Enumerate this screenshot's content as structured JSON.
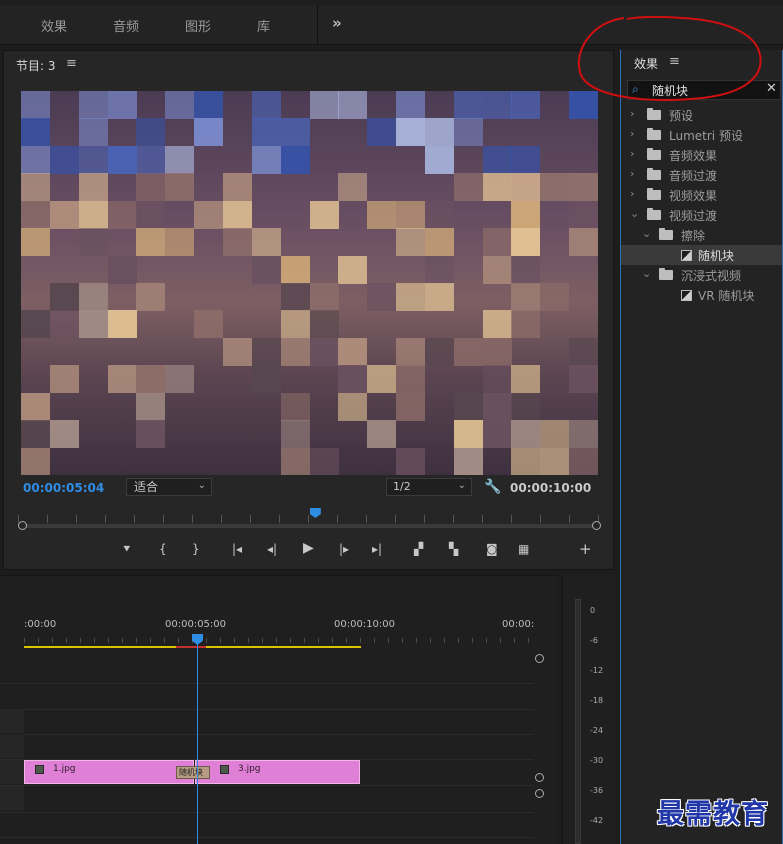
{
  "top_tabs": [
    "效果",
    "音频",
    "图形",
    "库"
  ],
  "program_monitor": {
    "title": "节目: 3",
    "current_timecode": "00:00:05:04",
    "fit_option": "适合",
    "resolution": "1/2",
    "duration_timecode": "00:00:10:00",
    "playhead_fraction": 0.51
  },
  "effects_panel": {
    "title": "效果",
    "search_value": "随机块",
    "tree": [
      {
        "label": "预设",
        "level": 0,
        "expanded": false,
        "type": "folder-star"
      },
      {
        "label": "Lumetri 预设",
        "level": 0,
        "expanded": false,
        "type": "folder-star"
      },
      {
        "label": "音频效果",
        "level": 0,
        "expanded": false,
        "type": "folder"
      },
      {
        "label": "音频过渡",
        "level": 0,
        "expanded": false,
        "type": "folder"
      },
      {
        "label": "视频效果",
        "level": 0,
        "expanded": false,
        "type": "folder"
      },
      {
        "label": "视频过渡",
        "level": 0,
        "expanded": true,
        "type": "folder"
      },
      {
        "label": "擦除",
        "level": 1,
        "expanded": true,
        "type": "folder"
      },
      {
        "label": "随机块",
        "level": 2,
        "type": "effect",
        "selected": true
      },
      {
        "label": "沉浸式视频",
        "level": 1,
        "expanded": true,
        "type": "folder"
      },
      {
        "label": "VR 随机块",
        "level": 2,
        "type": "effect",
        "vr_prefix": "VR",
        "name": "随机块"
      }
    ]
  },
  "timeline": {
    "ruler_labels": [
      ":00:00",
      "00:00:05:00",
      "00:00:10:00",
      "00:00:"
    ],
    "clips": [
      {
        "label": "1.jpg"
      },
      {
        "label": "3.jpg"
      }
    ],
    "transition_label": "随机块"
  },
  "audio_meter": {
    "db_labels": [
      "0",
      "-6",
      "-12",
      "-18",
      "-24",
      "-30",
      "-36",
      "-42"
    ]
  },
  "watermark": "最需教育",
  "colors": {
    "accent_blue": "#2f8de4",
    "clip_pink": "#e07fd6",
    "work_area_yellow": "#d8c400",
    "annotation_red": "#d01010"
  }
}
